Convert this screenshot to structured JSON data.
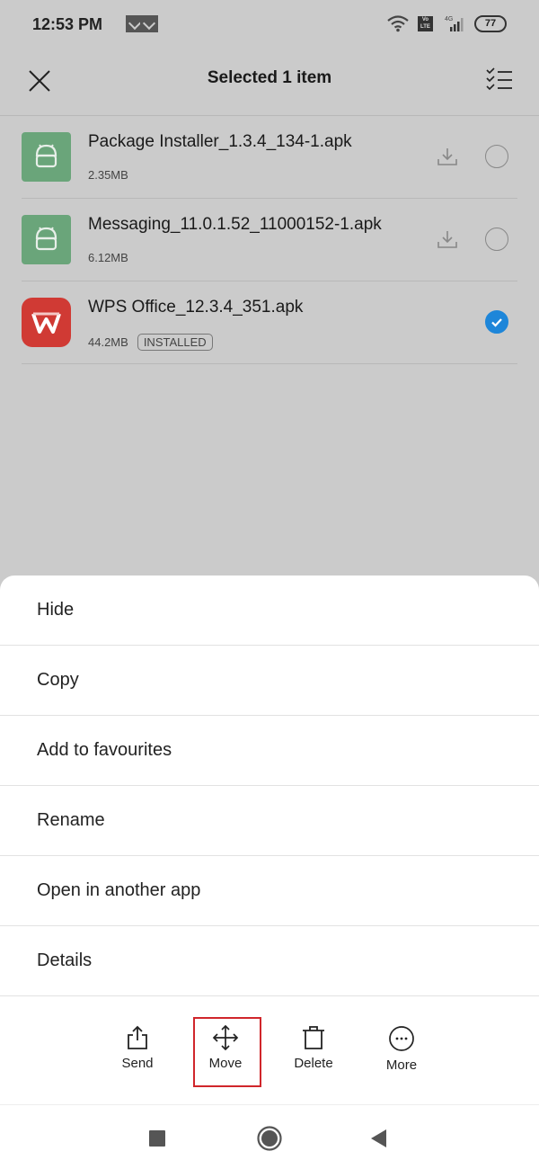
{
  "status_bar": {
    "time": "12:53 PM",
    "notification_icons": [
      "app-notification-icon",
      "app-notification-icon"
    ],
    "volte": "Vo LTE",
    "network": "4G",
    "battery": "77"
  },
  "app_bar": {
    "title": "Selected 1 item",
    "close_icon": "close-icon",
    "select_all_icon": "select-all-icon"
  },
  "files": [
    {
      "name": "Package Installer_1.3.4_134-1.apk",
      "size": "2.35MB",
      "icon": "android-apk-icon",
      "badge": null,
      "selected": false,
      "download": true
    },
    {
      "name": "Messaging_11.0.1.52_11000152-1.apk",
      "size": "6.12MB",
      "icon": "android-apk-icon",
      "badge": null,
      "selected": false,
      "download": true
    },
    {
      "name": "WPS Office_12.3.4_351.apk",
      "size": "44.2MB",
      "icon": "wps-office-icon",
      "badge": "INSTALLED",
      "selected": true,
      "download": false
    }
  ],
  "menu": {
    "items": [
      "Hide",
      "Copy",
      "Add to favourites",
      "Rename",
      "Open in another app",
      "Details"
    ]
  },
  "actions": [
    {
      "label": "Send",
      "icon": "share-icon"
    },
    {
      "label": "Move",
      "icon": "move-icon",
      "highlighted": true
    },
    {
      "label": "Delete",
      "icon": "trash-icon"
    },
    {
      "label": "More",
      "icon": "more-icon"
    }
  ],
  "colors": {
    "accent": "#1e86d9",
    "highlight_box": "#d0262b",
    "apk_icon": "#6aa57a",
    "wps_icon": "#d03a34"
  }
}
